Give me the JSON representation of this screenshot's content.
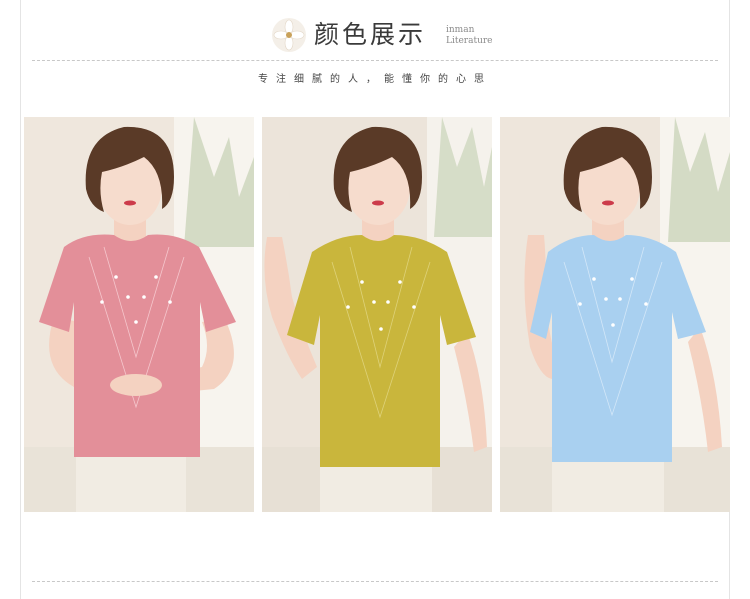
{
  "header": {
    "title": "颜色展示",
    "brand_line1": "inman",
    "brand_line2": "Literature",
    "flower_icon": "flower-icon"
  },
  "subtitle": "专注细腻的人，能懂你的心思",
  "colors": {
    "pink": "#e38f99",
    "yellow": "#c9b63c",
    "blue": "#a9d0f0",
    "pants": "#f1ece3",
    "hair": "#5a3a27",
    "wall": "#efe7dd"
  },
  "photos": [
    {
      "name": "pink-top-model",
      "top_color": "#e38f99"
    },
    {
      "name": "yellow-top-model",
      "top_color": "#c9b63c"
    },
    {
      "name": "blue-top-model",
      "top_color": "#a9d0f0"
    }
  ]
}
